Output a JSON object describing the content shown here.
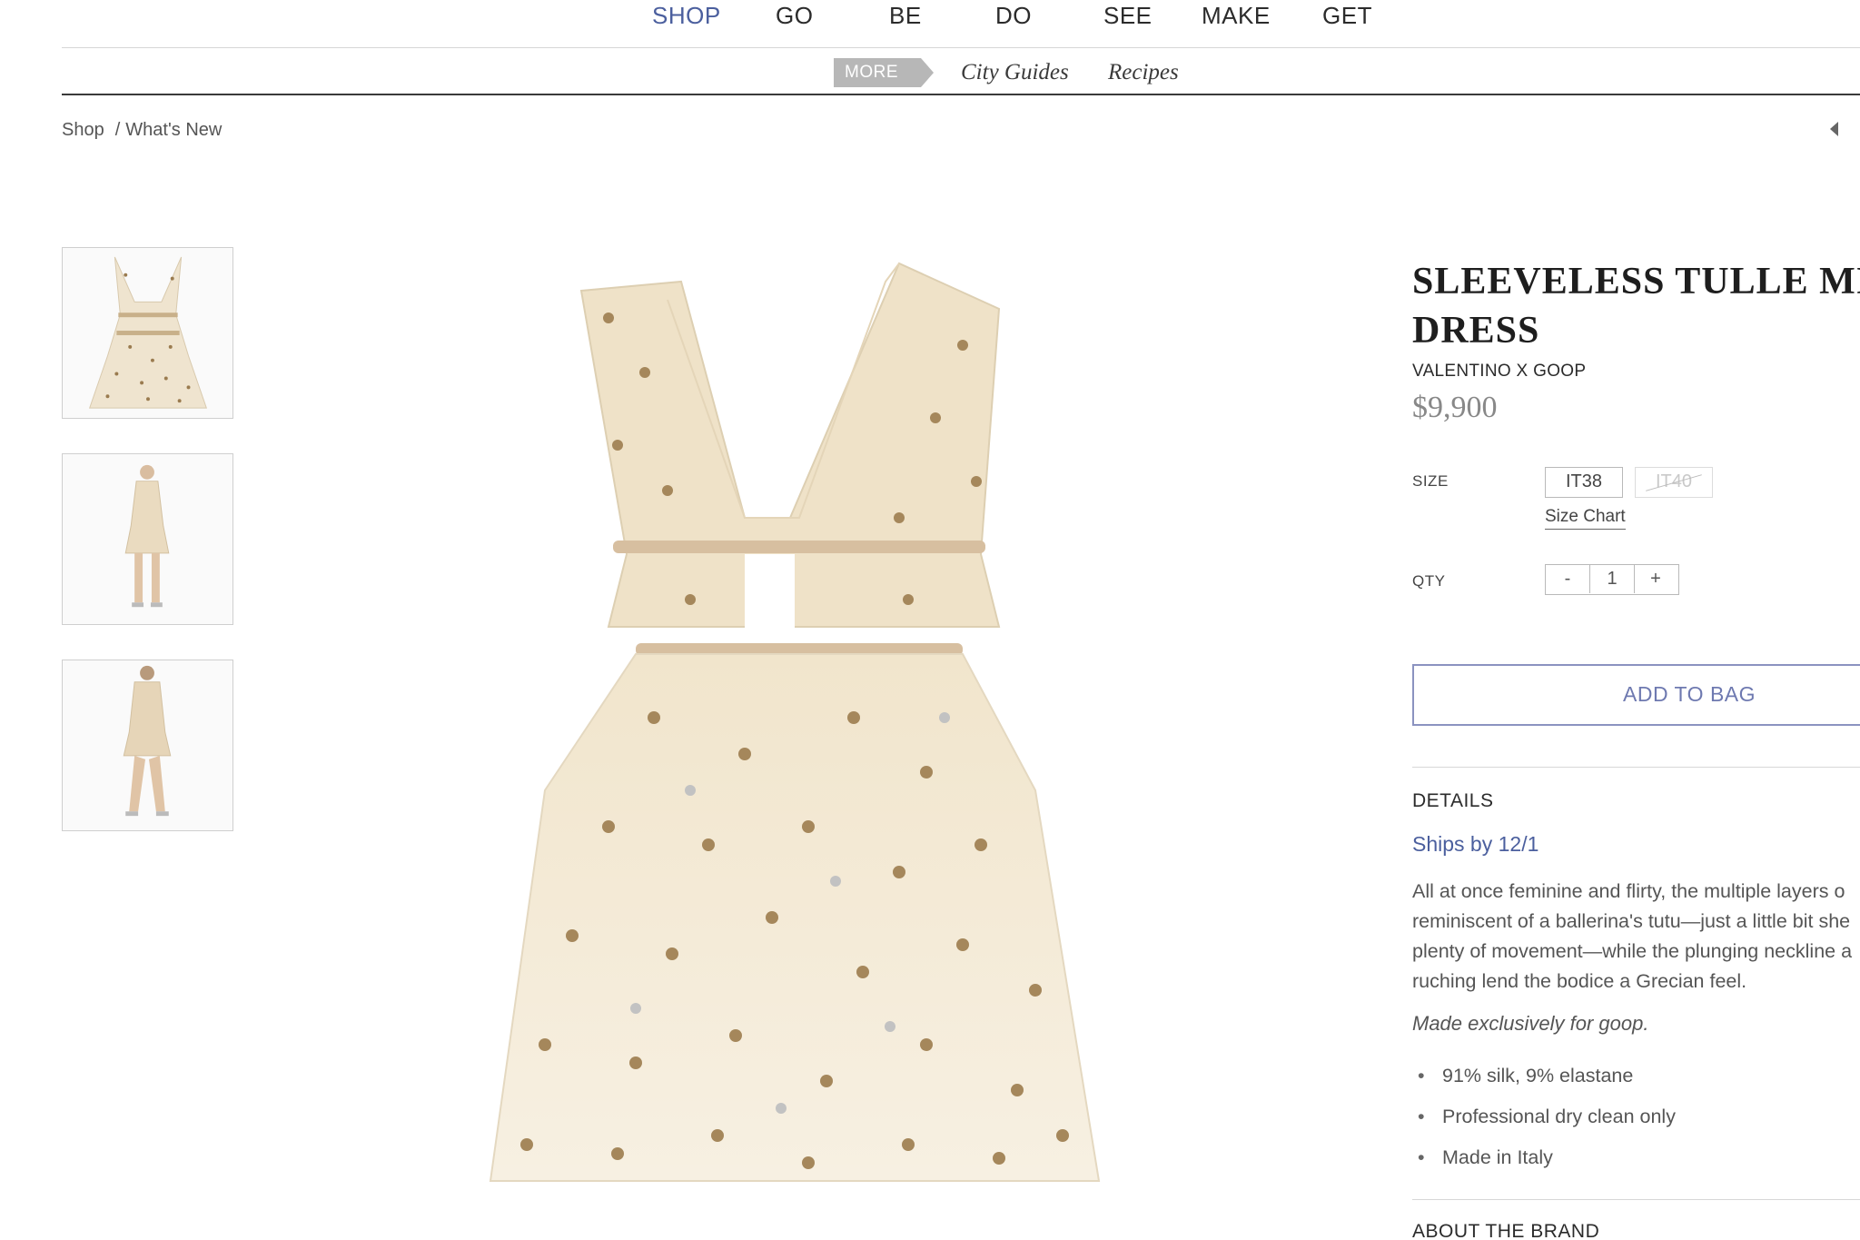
{
  "nav": {
    "items": [
      {
        "label": "SHOP",
        "active": true
      },
      {
        "label": "GO"
      },
      {
        "label": "BE"
      },
      {
        "label": "DO"
      },
      {
        "label": "SEE"
      },
      {
        "label": "MAKE"
      },
      {
        "label": "GET"
      }
    ],
    "more_label": "MORE",
    "sub_links": [
      "City Guides",
      "Recipes"
    ]
  },
  "breadcrumb": {
    "items": [
      "Shop",
      "What's New"
    ],
    "separator": "/"
  },
  "thumbnails": [
    {
      "alt": "dress-front"
    },
    {
      "alt": "model-front"
    },
    {
      "alt": "model-back"
    }
  ],
  "product": {
    "title_line1": "SLEEVELESS TULLE MI",
    "title_line2": "DRESS",
    "brand": "VALENTINO X GOOP",
    "price": "$9,900",
    "size_label": "SIZE",
    "sizes": [
      {
        "label": "IT38",
        "available": true
      },
      {
        "label": "IT40",
        "available": false
      }
    ],
    "size_chart_label": "Size Chart",
    "qty_label": "QTY",
    "qty": {
      "minus": "-",
      "value": "1",
      "plus": "+"
    },
    "add_to_bag": "ADD TO BAG",
    "details_heading": "DETAILS",
    "ships": "Ships by 12/1",
    "description": [
      "All at once feminine and flirty, the multiple layers o",
      "reminiscent of a ballerina's tutu—just a little bit she",
      "plenty of movement—while the plunging neckline a",
      "ruching lend the bodice a Grecian feel."
    ],
    "exclusive": "Made exclusively for goop.",
    "bullets": [
      "91% silk, 9% elastane",
      "Professional dry clean only",
      "Made in Italy"
    ],
    "about_heading": "ABOUT THE BRAND"
  },
  "colors": {
    "accent": "#4b5f9e",
    "button_border": "#8b93c0",
    "dress": "#f3ead8",
    "star_gold": "#9a7b4f"
  },
  "icons": {
    "prev": "chevron-left-icon"
  }
}
